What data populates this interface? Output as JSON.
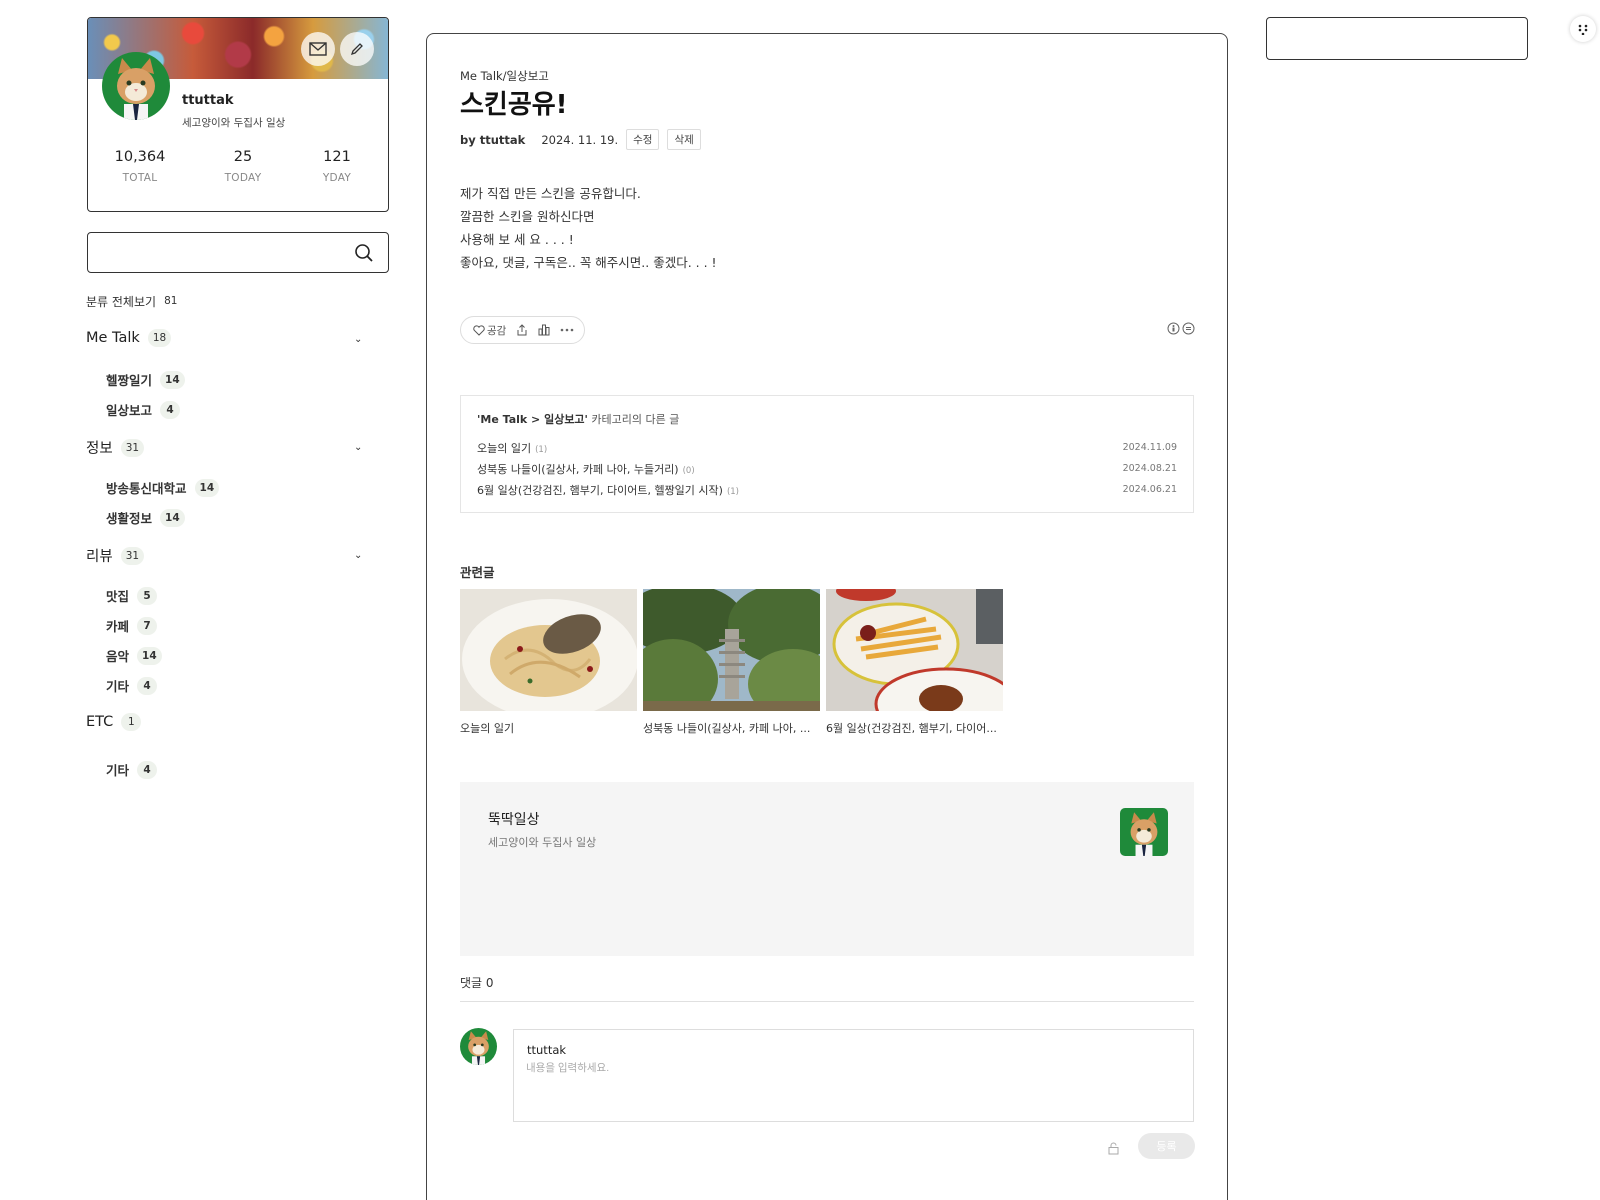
{
  "profile": {
    "name": "ttuttak",
    "description": "세고양이와 두집사 일상",
    "stats": [
      {
        "value": "10,364",
        "label": "TOTAL"
      },
      {
        "value": "25",
        "label": "TODAY"
      },
      {
        "value": "121",
        "label": "YDAY"
      }
    ],
    "icons": {
      "mail": "mail-icon",
      "edit": "pencil-icon"
    }
  },
  "search": {
    "placeholder": ""
  },
  "categories": {
    "all": {
      "label": "분류 전체보기",
      "count": "81"
    },
    "groups": [
      {
        "label": "Me Talk",
        "count": "18",
        "children": [
          {
            "label": "헬짱일기",
            "count": "14"
          },
          {
            "label": "일상보고",
            "count": "4"
          }
        ]
      },
      {
        "label": "정보",
        "count": "31",
        "children": [
          {
            "label": "방송통신대학교",
            "count": "14"
          },
          {
            "label": "생활정보",
            "count": "14"
          }
        ]
      },
      {
        "label": "리뷰",
        "count": "31",
        "children": [
          {
            "label": "맛집",
            "count": "5"
          },
          {
            "label": "카페",
            "count": "7"
          },
          {
            "label": "음악",
            "count": "14"
          },
          {
            "label": "기타",
            "count": "4"
          }
        ]
      },
      {
        "label": "ETC",
        "count": "1",
        "children": [
          {
            "label": "기타",
            "count": "4"
          }
        ]
      }
    ]
  },
  "post": {
    "category": "Me Talk/일상보고",
    "title": "스킨공유!",
    "author": "by ttuttak",
    "date": "2024. 11. 19.",
    "edit_label": "수정",
    "delete_label": "삭제",
    "body": [
      "제가 직접 만든 스킨을 공유합니다.",
      "깔끔한 스킨을 원하신다면",
      "사용해 보 세 요 . . . !",
      "좋아요, 댓글, 구독은.. 꼭 해주시면.. 좋겠다. . . !"
    ],
    "like_label": "공감"
  },
  "other_posts": {
    "heading_bold": "'Me Talk > 일상보고'",
    "heading_rest": " 카테고리의 다른 글",
    "items": [
      {
        "title": "오늘의 일기",
        "count": "(1)",
        "date": "2024.11.09"
      },
      {
        "title": "성북동 나들이(길상사, 카페 나아, 누들거리)",
        "count": "(0)",
        "date": "2024.08.21"
      },
      {
        "title": "6월 일상(건강검진, 햄부기, 다이어트, 헬짱일기 시작)",
        "count": "(1)",
        "date": "2024.06.21"
      }
    ]
  },
  "related": {
    "title": "관련글",
    "items": [
      {
        "caption": "오늘의 일기"
      },
      {
        "caption": "성북동 나들이(길상사, 카페 나아, ..."
      },
      {
        "caption": "6월 일상(건강검진, 햄부기, 다이어..."
      }
    ]
  },
  "blog_card": {
    "name": "뚝딱일상",
    "description": "세고양이와 두집사 일상"
  },
  "comments": {
    "count_label": "댓글 0",
    "user": "ttuttak",
    "placeholder": "내용을 입력하세요.",
    "submit_label": "등록"
  },
  "colors": {
    "accent_green": "#1f8a3a",
    "badge_bg": "#eef2ec",
    "border": "#333333"
  }
}
